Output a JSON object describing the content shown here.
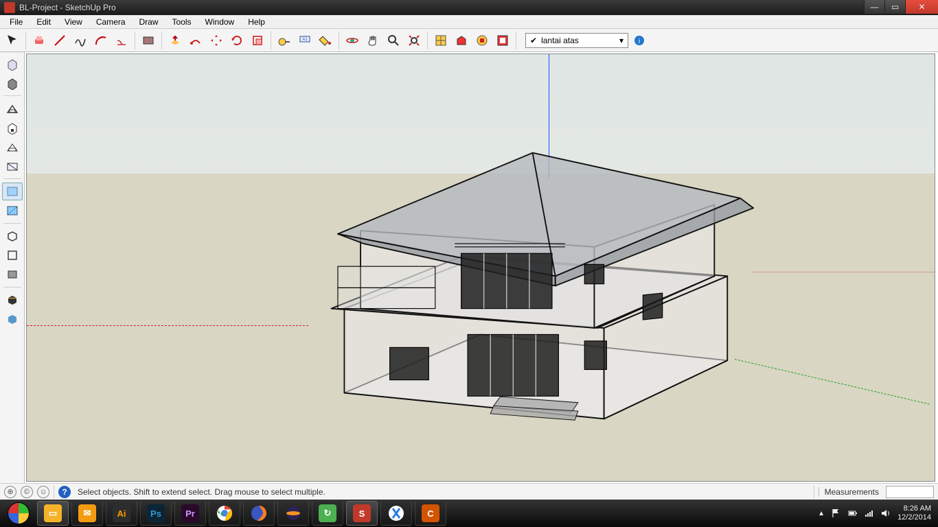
{
  "window": {
    "title": "BL-Project - SketchUp Pro"
  },
  "menu": [
    "File",
    "Edit",
    "View",
    "Camera",
    "Draw",
    "Tools",
    "Window",
    "Help"
  ],
  "layer": {
    "selected": "lantai atas"
  },
  "status": {
    "hint": "Select objects. Shift to extend select. Drag mouse to select multiple.",
    "measurements_label": "Measurements"
  },
  "tray": {
    "time": "8:26 AM",
    "date": "12/2/2014"
  }
}
